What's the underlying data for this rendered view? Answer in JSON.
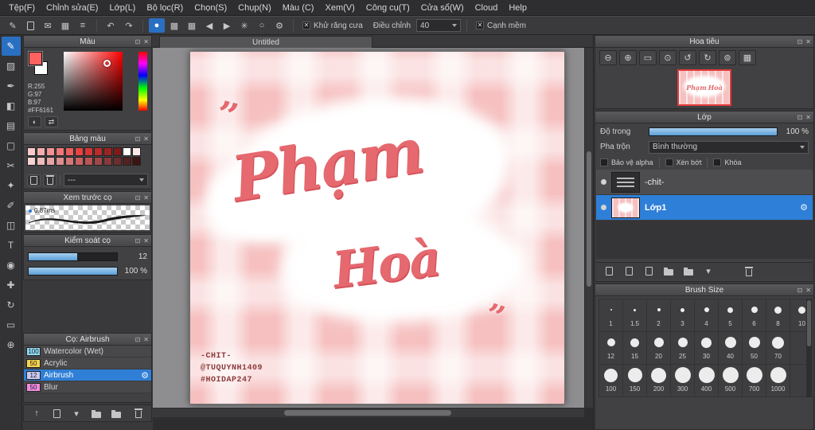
{
  "icons": {
    "gear": "⚙",
    "undo": "↶",
    "redo": "↷"
  },
  "panel_controls": {
    "float": "⊡",
    "close": "✕"
  },
  "menu": {
    "items": [
      "Tệp(F)",
      "Chỉnh sửa(E)",
      "Lớp(L)",
      "Bộ lọc(R)",
      "Chọn(S)",
      "Chụp(N)",
      "Màu (C)",
      "Xem(V)",
      "Công cụ(T)",
      "Cửa sổ(W)",
      "Cloud",
      "Help"
    ]
  },
  "toolbar": {
    "left_icons": [
      {
        "name": "paint-brush-icon",
        "glyph": "✎"
      },
      {
        "name": "clipboard-icon",
        "glyph": "css:doc"
      },
      {
        "name": "comment-icon",
        "glyph": "✉"
      },
      {
        "name": "grid-view-icon",
        "glyph": "▦"
      },
      {
        "name": "panel-layout-icon",
        "glyph": "≡"
      }
    ],
    "tool_icons": [
      {
        "name": "freehand-brush-icon",
        "glyph": "●",
        "selected": true
      },
      {
        "name": "eraser-mode-icon",
        "glyph": "▩"
      },
      {
        "name": "pixel-grid-icon",
        "glyph": "▦"
      },
      {
        "name": "prev-snap-icon",
        "glyph": "◀"
      },
      {
        "name": "next-snap-icon",
        "glyph": "▶"
      },
      {
        "name": "snap-radial-icon",
        "glyph": "✳"
      },
      {
        "name": "snap-ellipse-icon",
        "glyph": "○"
      },
      {
        "name": "brush-settings-icon",
        "glyph": "⚙"
      }
    ],
    "check_mark": "✕",
    "antialias_label": "Khử răng cưa",
    "adjust_label": "Điều chỉnh",
    "adjust_value": "40",
    "soft_edge_label": "Cạnh mềm"
  },
  "tools": [
    {
      "name": "brush-tool",
      "glyph": "✎",
      "selected": true
    },
    {
      "name": "eraser-tool",
      "glyph": "▨"
    },
    {
      "name": "pen-tool",
      "glyph": "✒"
    },
    {
      "name": "bucket-tool",
      "glyph": "◧"
    },
    {
      "name": "gradient-tool",
      "glyph": "▤"
    },
    {
      "name": "select-tool",
      "glyph": "▢"
    },
    {
      "name": "lasso-tool",
      "glyph": "✂"
    },
    {
      "name": "magic-wand-tool",
      "glyph": "✦"
    },
    {
      "name": "select-pen-tool",
      "glyph": "✐"
    },
    {
      "name": "select-eraser-tool",
      "glyph": "◫"
    },
    {
      "name": "text-tool",
      "glyph": "T"
    },
    {
      "name": "eyedropper-tool",
      "glyph": "◉"
    },
    {
      "name": "move-tool",
      "glyph": "✚"
    },
    {
      "name": "rotate-tool",
      "glyph": "↻"
    },
    {
      "name": "frame-tool",
      "glyph": "▭"
    },
    {
      "name": "zoom-tool",
      "glyph": "⊕"
    }
  ],
  "color_panel": {
    "title": "Màu",
    "r": "R:255",
    "g": "G:97",
    "b": "B:97",
    "hex": "#FF6161",
    "fg": "#ff6161",
    "bg": "#ffffff",
    "buttons": [
      {
        "name": "color-picker-icon",
        "glyph": "◐"
      },
      {
        "name": "swap-colors-icon",
        "glyph": "⇄"
      }
    ]
  },
  "palette_panel": {
    "title": "Bảng màu",
    "dropdown": "---",
    "toolbar": [
      {
        "name": "new-swatch-icon",
        "glyph": "css:doc"
      },
      {
        "name": "delete-swatch-icon",
        "glyph": "css:trash"
      }
    ],
    "swatches": [
      "#f8c9c9",
      "#f5aeae",
      "#f29393",
      "#ef7878",
      "#ec5d5d",
      "#e94242",
      "#d63535",
      "#ba2b2b",
      "#9d2222",
      "#801a1a",
      "#ffffff",
      "#fbe9e9",
      "#f6d2d2",
      "#eebcbc",
      "#e5a5a5",
      "#dc8f8f",
      "#d37878",
      "#ca6262",
      "#b95454",
      "#a04747",
      "#873a3a",
      "#6e2d2d",
      "#552020",
      "#3c1414"
    ]
  },
  "preview_panel": {
    "title": "Xem trước cọ",
    "speed": "0.87ms"
  },
  "control_panel": {
    "title": "Kiểm soát cọ",
    "size_value": "12",
    "opacity_value": "100 %"
  },
  "brush_panel": {
    "title": "Cọ: Airbrush",
    "items": [
      {
        "size": "100",
        "name": "Watercolor (Wet)",
        "chip": "#8fd8f5",
        "selected": false
      },
      {
        "size": "50",
        "name": "Acrylic",
        "chip": "#f5d44e",
        "selected": false
      },
      {
        "size": "12",
        "name": "Airbrush",
        "chip": "#c9c9f2",
        "selected": true
      },
      {
        "size": "50",
        "name": "Blur",
        "chip": "#f08ae0",
        "selected": false
      }
    ]
  },
  "left_bottom_icons": [
    {
      "name": "export-brush-icon",
      "glyph": "↑"
    },
    {
      "name": "new-brush-icon",
      "glyph": "css:doc"
    },
    {
      "name": "brush-menu-icon",
      "glyph": "▾"
    },
    {
      "name": "brush-folder-icon",
      "glyph": "css:folder"
    },
    {
      "name": "brush-group-icon",
      "glyph": "css:folder"
    },
    {
      "name": "delete-brush-icon",
      "glyph": "css:trash"
    }
  ],
  "canvas": {
    "tab": "Untitled",
    "word1": "Phạm",
    "word2": "Hoà",
    "quote_mark": "”",
    "credits": [
      "-CHIT-",
      "@TUQUYNH1409",
      "#HOIDAP247"
    ]
  },
  "navigator": {
    "title": "Hoa tiêu",
    "icons": [
      {
        "name": "zoom-out-icon",
        "glyph": "⊖"
      },
      {
        "name": "zoom-in-icon",
        "glyph": "⊕"
      },
      {
        "name": "zoom-fit-icon",
        "glyph": "▭"
      },
      {
        "name": "zoom-100-icon",
        "glyph": "⊙"
      },
      {
        "name": "rotate-ccw-icon",
        "glyph": "↺"
      },
      {
        "name": "rotate-cw-icon",
        "glyph": "↻"
      },
      {
        "name": "reset-view-icon",
        "glyph": "⊚"
      },
      {
        "name": "snapshot-icon",
        "glyph": "▦"
      }
    ]
  },
  "layers_panel": {
    "title": "Lớp",
    "opacity_label": "Độ trong",
    "opacity_value": "100 %",
    "blend_label": "Pha trộn",
    "blend_value": "Bình thường",
    "check_labels": [
      "Bảo vệ alpha",
      "Xén bớt",
      "Khóa"
    ],
    "layers": [
      {
        "name": "-chit-",
        "selected": false,
        "thumb": "dark"
      },
      {
        "name": "Lớp1",
        "selected": true,
        "thumb": "pink"
      }
    ],
    "toolbar": [
      {
        "name": "new-layer-icon",
        "glyph": "css:doc"
      },
      {
        "name": "duplicate-layer-icon",
        "glyph": "css:doc"
      },
      {
        "name": "import-layer-icon",
        "glyph": "css:doc"
      },
      {
        "name": "new-layer-folder-icon",
        "glyph": "css:folder"
      },
      {
        "name": "layer-folder-icon",
        "glyph": "css:folder"
      },
      {
        "name": "layer-menu-icon",
        "glyph": "▾"
      },
      {
        "name": "delete-layer-icon",
        "glyph": "css:trash"
      }
    ]
  },
  "brush_size_panel": {
    "title": "Brush Size",
    "rows": [
      [
        "1",
        "1.5",
        "2",
        "3",
        "4",
        "5",
        "6",
        "8",
        "10"
      ],
      [
        "12",
        "15",
        "20",
        "25",
        "30",
        "40",
        "50",
        "70"
      ],
      [
        "100",
        "150",
        "200",
        "300",
        "400",
        "500",
        "700",
        "1000"
      ]
    ]
  }
}
